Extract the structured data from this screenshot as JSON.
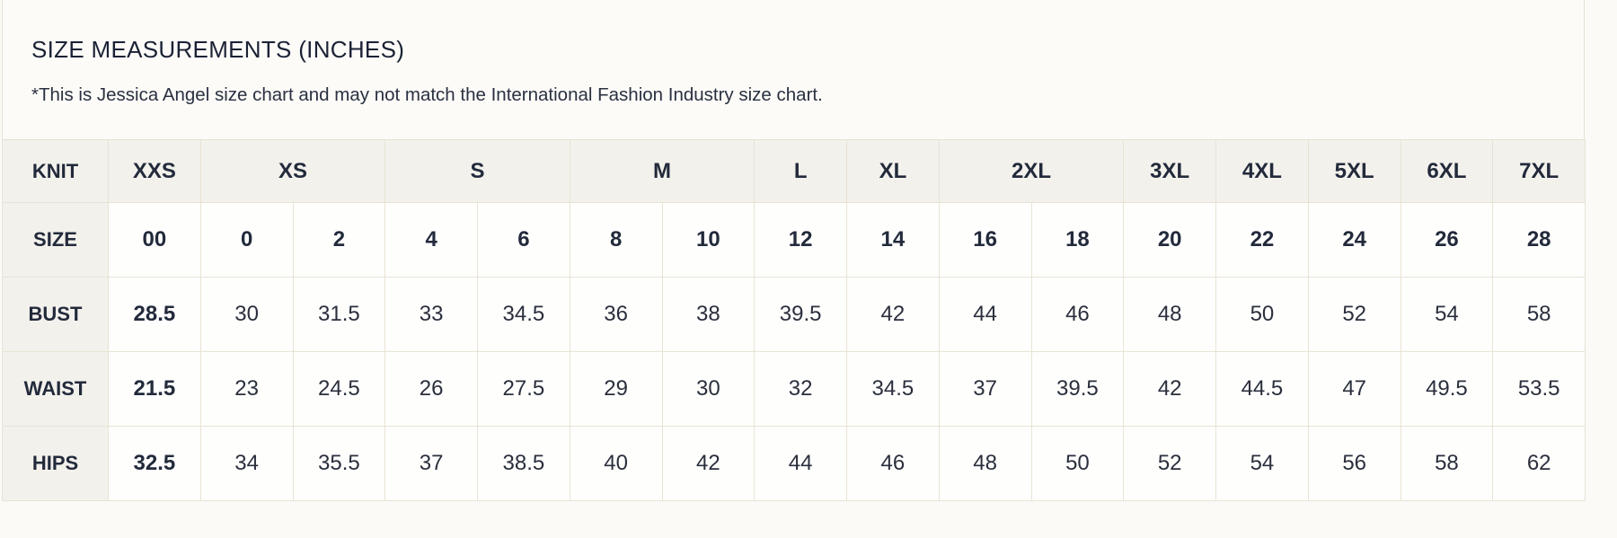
{
  "heading": {
    "title": "SIZE MEASUREMENTS (INCHES)",
    "note": "*This is Jessica Angel size chart and may not match the International Fashion Industry size chart."
  },
  "table": {
    "header_label": "KNIT",
    "groups": [
      {
        "label": "XXS",
        "span": 1
      },
      {
        "label": "XS",
        "span": 2
      },
      {
        "label": "S",
        "span": 2
      },
      {
        "label": "M",
        "span": 2
      },
      {
        "label": "L",
        "span": 1
      },
      {
        "label": "XL",
        "span": 1
      },
      {
        "label": "2XL",
        "span": 2
      },
      {
        "label": "3XL",
        "span": 1
      },
      {
        "label": "4XL",
        "span": 1
      },
      {
        "label": "5XL",
        "span": 1
      },
      {
        "label": "6XL",
        "span": 1
      },
      {
        "label": "7XL",
        "span": 1
      }
    ],
    "rows": [
      {
        "label": "SIZE",
        "values": [
          "00",
          "0",
          "2",
          "4",
          "6",
          "8",
          "10",
          "12",
          "14",
          "16",
          "18",
          "20",
          "22",
          "24",
          "26",
          "28"
        ]
      },
      {
        "label": "BUST",
        "values": [
          "28.5",
          "30",
          "31.5",
          "33",
          "34.5",
          "36",
          "38",
          "39.5",
          "42",
          "44",
          "46",
          "48",
          "50",
          "52",
          "54",
          "58"
        ]
      },
      {
        "label": "WAIST",
        "values": [
          "21.5",
          "23",
          "24.5",
          "26",
          "27.5",
          "29",
          "30",
          "32",
          "34.5",
          "37",
          "39.5",
          "42",
          "44.5",
          "47",
          "49.5",
          "53.5"
        ]
      },
      {
        "label": "HIPS",
        "values": [
          "32.5",
          "34",
          "35.5",
          "37",
          "38.5",
          "40",
          "42",
          "44",
          "46",
          "48",
          "50",
          "52",
          "54",
          "56",
          "58",
          "62"
        ]
      }
    ]
  }
}
